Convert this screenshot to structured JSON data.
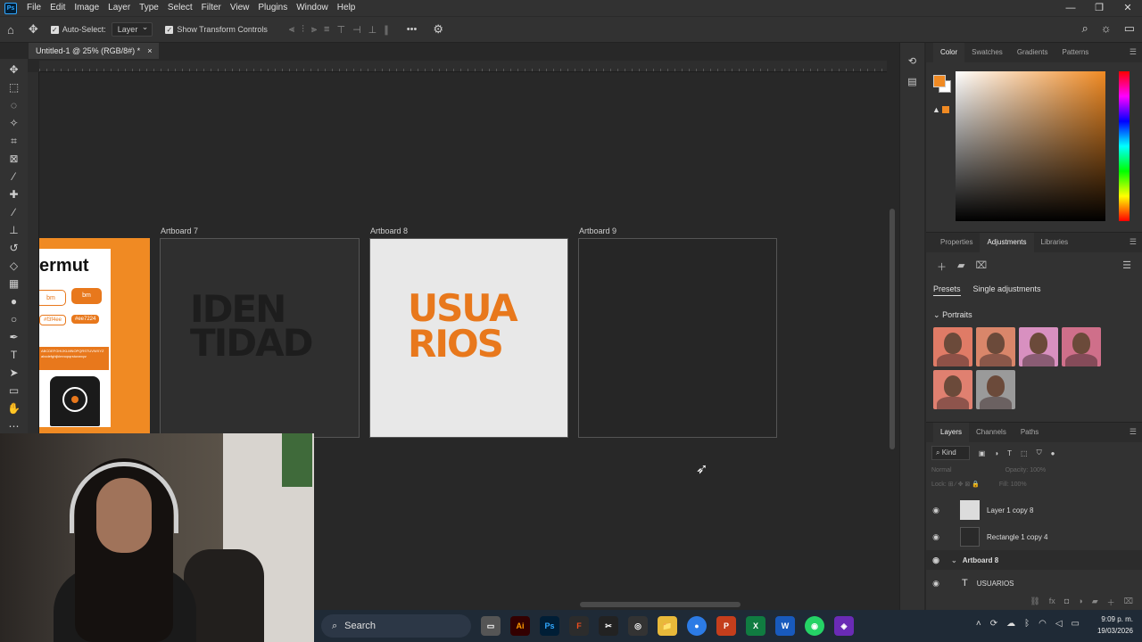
{
  "app": {
    "logo_text": "Ps",
    "menu": [
      "File",
      "Edit",
      "Image",
      "Layer",
      "Type",
      "Select",
      "Filter",
      "View",
      "Plugins",
      "Window",
      "Help"
    ],
    "window_controls": [
      "—",
      "❐",
      "✕"
    ]
  },
  "options_bar": {
    "auto_select_label": "Auto-Select:",
    "auto_select_checked": true,
    "target_value": "Layer",
    "transform_label": "Show Transform Controls",
    "transform_checked": true,
    "more_label": "•••"
  },
  "document": {
    "tab_title": "Untitled-1 @ 25% (RGB/8#) *",
    "close_glyph": "×"
  },
  "canvas": {
    "artboards": [
      {
        "label": "Artboard 7",
        "text": "IDEN TIDAD"
      },
      {
        "label": "Artboard 8",
        "text": "USUA RIOS"
      },
      {
        "label": "Artboard 9",
        "text": ""
      }
    ],
    "brand_board": {
      "name": "ermut",
      "button_1": "bm",
      "button_2": "bm",
      "hex_1": "#f3f4ee",
      "hex_2": "#ee7224",
      "alphabet": "ABCDEFGHIJKLMNOPQRSTUVWXYZ abcdefghijklmnopqrstuvwxyz"
    }
  },
  "color_panel": {
    "tabs": [
      "Color",
      "Swatches",
      "Gradients",
      "Patterns"
    ],
    "active_tab": "Color",
    "foreground": "#f08a23",
    "background": "#ffffff"
  },
  "adjustments_panel": {
    "tabs": [
      "Properties",
      "Adjustments",
      "Libraries"
    ],
    "active_tab": "Adjustments",
    "subtabs": [
      "Presets",
      "Single adjustments"
    ],
    "group_label": "Portraits",
    "thumb_colors": [
      "#e07b66",
      "#d9866a",
      "#d890c0",
      "#cf6f8a",
      "#e08070",
      "#9a9a9a"
    ]
  },
  "layers_panel": {
    "tabs": [
      "Layers",
      "Channels",
      "Paths"
    ],
    "active_tab": "Layers",
    "kind_label": "Kind",
    "blend_mode": "Normal",
    "opacity_label": "Opacity:",
    "opacity_value": "100%",
    "lock_label": "Lock:",
    "fill_label": "Fill:",
    "fill_value": "100%",
    "layers": [
      {
        "name": "Layer 1 copy 8",
        "thumb": "#dcdcdc"
      },
      {
        "name": "Rectangle 1 copy 4",
        "thumb": "#2a2a2a"
      },
      {
        "name": "Artboard 8",
        "thumb": ""
      },
      {
        "name": "USUARIOS",
        "thumb": ""
      }
    ]
  },
  "taskbar": {
    "search_label": "Search",
    "apps": [
      "Ai",
      "Ps",
      "F",
      "✂",
      "◎",
      "📁",
      "●",
      "P",
      "X",
      "W",
      "◉",
      "◈"
    ],
    "time": "9:09 p. m.",
    "date": "19/03/2026"
  }
}
